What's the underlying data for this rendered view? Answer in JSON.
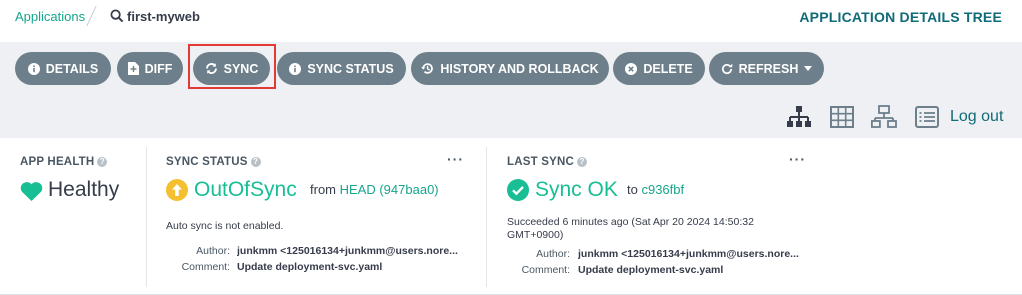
{
  "breadcrumb": {
    "parent": "Applications",
    "current": "first-myweb"
  },
  "page_title": "APPLICATION DETAILS TREE",
  "toolbar": {
    "buttons": [
      {
        "label": "DETAILS",
        "icon": "info-icon"
      },
      {
        "label": "DIFF",
        "icon": "file-diff-icon"
      },
      {
        "label": "SYNC",
        "icon": "sync-icon"
      },
      {
        "label": "SYNC STATUS",
        "icon": "info-icon"
      },
      {
        "label": "HISTORY AND ROLLBACK",
        "icon": "history-icon"
      },
      {
        "label": "DELETE",
        "icon": "delete-icon"
      },
      {
        "label": "REFRESH",
        "icon": "refresh-icon"
      }
    ]
  },
  "views": [
    "tree-view-icon",
    "grid-view-icon",
    "network-view-icon",
    "list-view-icon"
  ],
  "logout": "Log out",
  "app_health": {
    "label": "APP HEALTH",
    "status": "Healthy"
  },
  "sync_status": {
    "label": "SYNC STATUS",
    "status": "OutOfSync",
    "from_text": "from",
    "revision": "HEAD (947baa0)",
    "auto_sync": "Auto sync is not enabled.",
    "author_label": "Author:",
    "author": "junkmm <125016134+junkmm@users.nore...",
    "comment_label": "Comment:",
    "comment": "Update deployment-svc.yaml",
    "menu": "···"
  },
  "last_sync": {
    "label": "LAST SYNC",
    "status": "Sync OK",
    "to_text": "to",
    "revision": "c936fbf",
    "time_line1": "Succeeded 6 minutes ago (Sat Apr 20 2024 14:50:32",
    "time_line2": "GMT+0900)",
    "author_label": "Author:",
    "author": "junkmm <125016134+junkmm@users.nore...",
    "comment_label": "Comment:",
    "comment": "Update deployment-svc.yaml",
    "menu": "···"
  },
  "colors": {
    "accent": "#18a58c",
    "healthy": "#18be94",
    "out_of_sync": "#f4c030",
    "button": "#6d7f8b",
    "title": "#0f6b78"
  }
}
